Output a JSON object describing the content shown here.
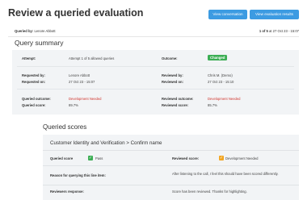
{
  "header": {
    "title": "Review a queried evaluation",
    "view_conversation": "View conversation",
    "view_results": "View evaluation results"
  },
  "meta": {
    "queried_by_label": "Queried by:",
    "queried_by_value": "Lenore Abbott",
    "page_info": "1 of 5",
    "page_date": " at 27 Oct 23 - 15:07"
  },
  "summary": {
    "heading": "Query summary",
    "attempt_label": "Attempt:",
    "attempt_value": "Attempt 1 of 5 allowed queries",
    "outcome_label": "Outcome:",
    "outcome_value": "Changed",
    "requested_by_label": "Requested by:",
    "requested_by_value": "Lenore Abbott",
    "reviewed_by_label": "Reviewed by:",
    "reviewed_by_value": "Chris M. (Demo)",
    "requested_on_label": "Requested on:",
    "requested_on_value": "27 Oct 23 - 15:07",
    "reviewed_on_label": "Reviewed on:",
    "reviewed_on_value": "27 Oct 23 - 15:10",
    "queried_outcome_label": "Queried outcome:",
    "queried_outcome_value": "Development Needed",
    "reviewed_outcome_label": "Reviewed outcome:",
    "reviewed_outcome_value": "Development Needed",
    "queried_score_label": "Queried score:",
    "queried_score_value": "89.7%",
    "reviewed_score_label": "Reviewed score:",
    "reviewed_score_value": "85.7%"
  },
  "queried_scores": {
    "heading": "Queried scores",
    "line_title": "Customer Identity and Verification > Confirm name",
    "queried_score_label": "Queried score",
    "queried_score_value": "Pass",
    "reviewed_score_label": "Reviewed score:",
    "reviewed_score_value": "Development Needed",
    "reason_label": "Reason for querying this line item:",
    "reason_value": "After listening to the call, I feel this should have been scored differently.",
    "response_label": "Reviewers response:",
    "response_value": "Score has been reviewed. Thanks for highlighting."
  },
  "colors": {
    "accent": "#3c9be2",
    "pass": "#3cae54",
    "dev_needed": "#f2a623",
    "red": "#d0342c"
  }
}
